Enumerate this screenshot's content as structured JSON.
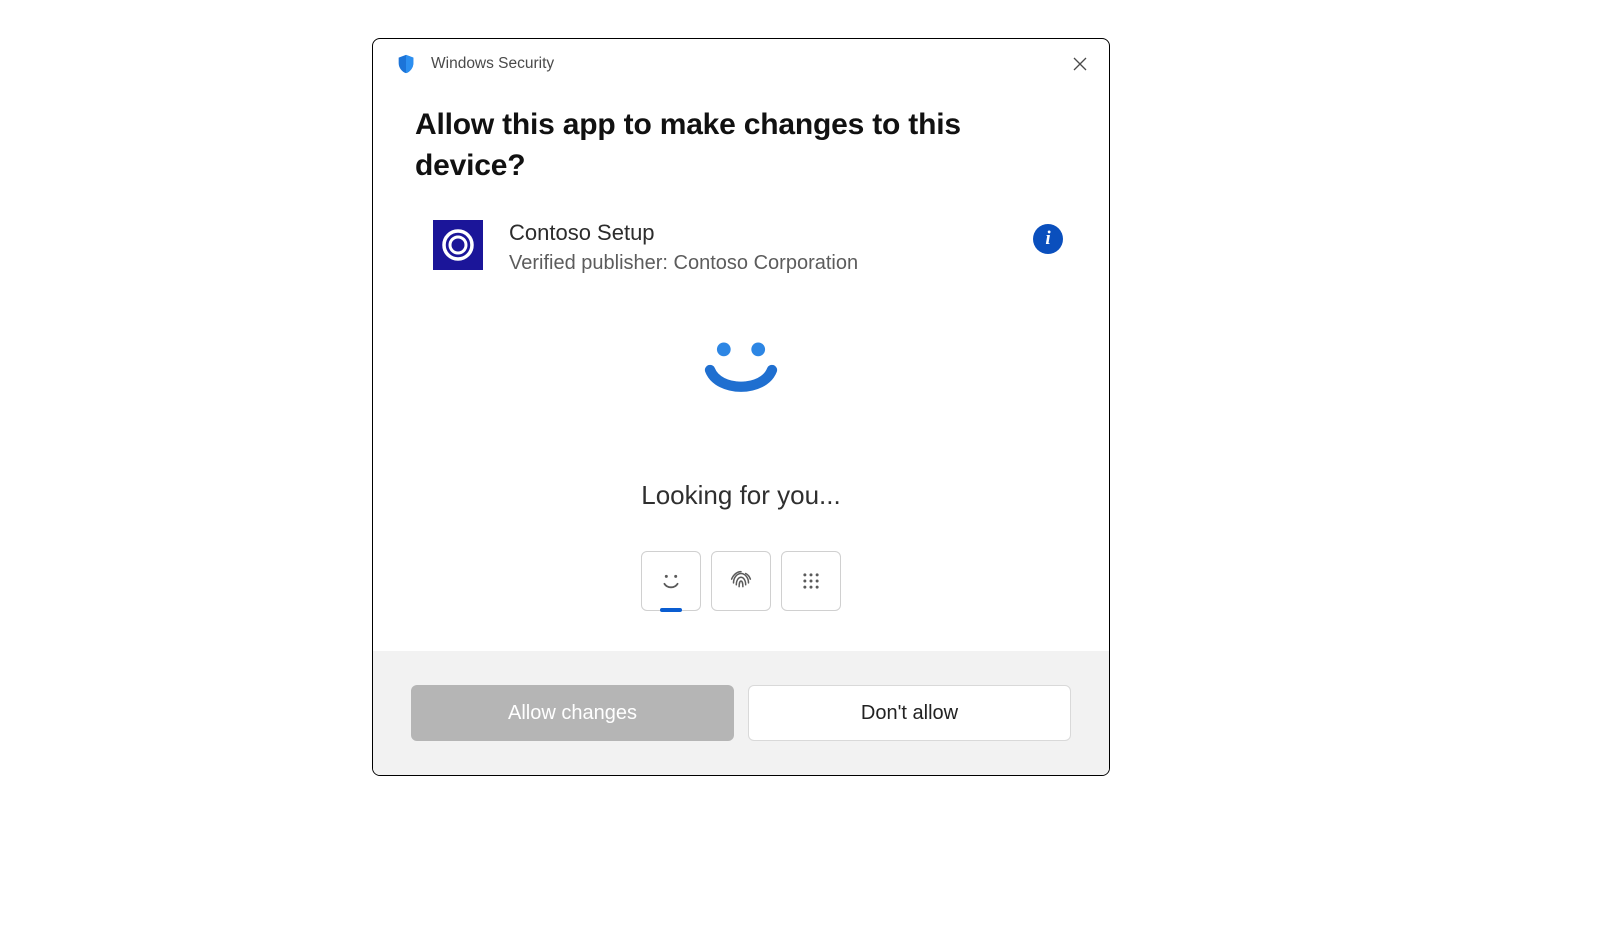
{
  "titlebar": {
    "title": "Windows Security"
  },
  "heading": "Allow this app to make changes to this device?",
  "app": {
    "name": "Contoso Setup",
    "publisher_line": "Verified publisher: Contoso Corporation"
  },
  "hello": {
    "status": "Looking for you...",
    "options": {
      "face": "face-recognition",
      "fingerprint": "fingerprint",
      "pin": "pin"
    },
    "selected": "face"
  },
  "buttons": {
    "allow": "Allow changes",
    "deny": "Don't allow"
  },
  "colors": {
    "accent_blue": "#0a5dd1",
    "info_blue": "#0a4fbd",
    "app_icon_bg": "#1b1599",
    "footer_bg": "#f2f2f2",
    "disabled_btn": "#b5b5b5"
  }
}
